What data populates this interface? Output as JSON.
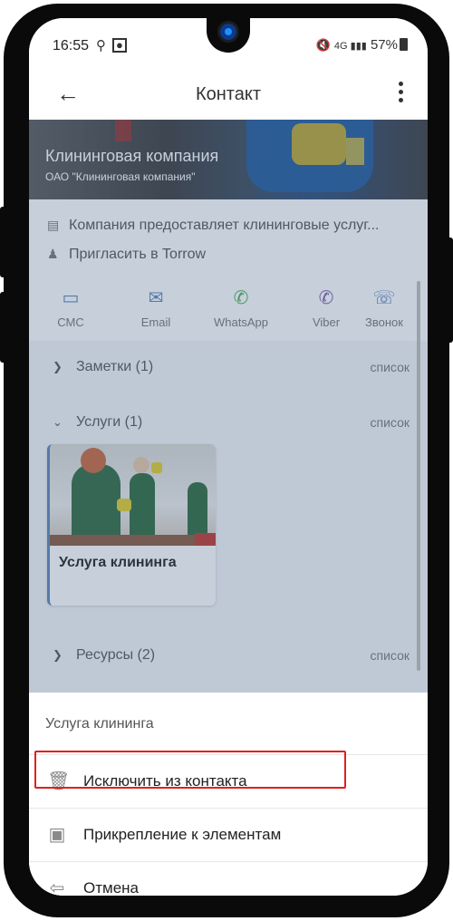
{
  "status_bar": {
    "time": "16:55",
    "battery": "57%"
  },
  "appbar": {
    "title": "Контакт"
  },
  "banner": {
    "title": "Клининговая компания",
    "subtitle": "ОАО \"Клининговая компания\""
  },
  "info": {
    "description": "Компания предоставляет клининговые услуг...",
    "invite": "Пригласить в Torrow"
  },
  "actions": [
    {
      "label": "СМС",
      "color": "#5b86b8"
    },
    {
      "label": "Email",
      "color": "#5b86b8"
    },
    {
      "label": "WhatsApp",
      "color": "#4caf50"
    },
    {
      "label": "Viber",
      "color": "#7b5ea7"
    },
    {
      "label": "Звонок",
      "color": "#5b86b8"
    }
  ],
  "sections": [
    {
      "label": "Заметки (1)",
      "link": "список",
      "expanded": false
    },
    {
      "label": "Услуги (1)",
      "link": "список",
      "expanded": true
    },
    {
      "label": "Ресурсы (2)",
      "link": "список",
      "expanded": false
    }
  ],
  "service_card": {
    "title": "Услуга клининга"
  },
  "sheet": {
    "title": "Услуга клининга",
    "items": [
      {
        "label": "Исключить из контакта",
        "icon": "trash-icon"
      },
      {
        "label": "Прикрепление к элементам",
        "icon": "attach-icon",
        "highlighted": true
      },
      {
        "label": "Отмена",
        "icon": "undo-icon"
      }
    ]
  },
  "colors": {
    "accent": "#5b86b8",
    "highlight_border": "#e02020"
  }
}
